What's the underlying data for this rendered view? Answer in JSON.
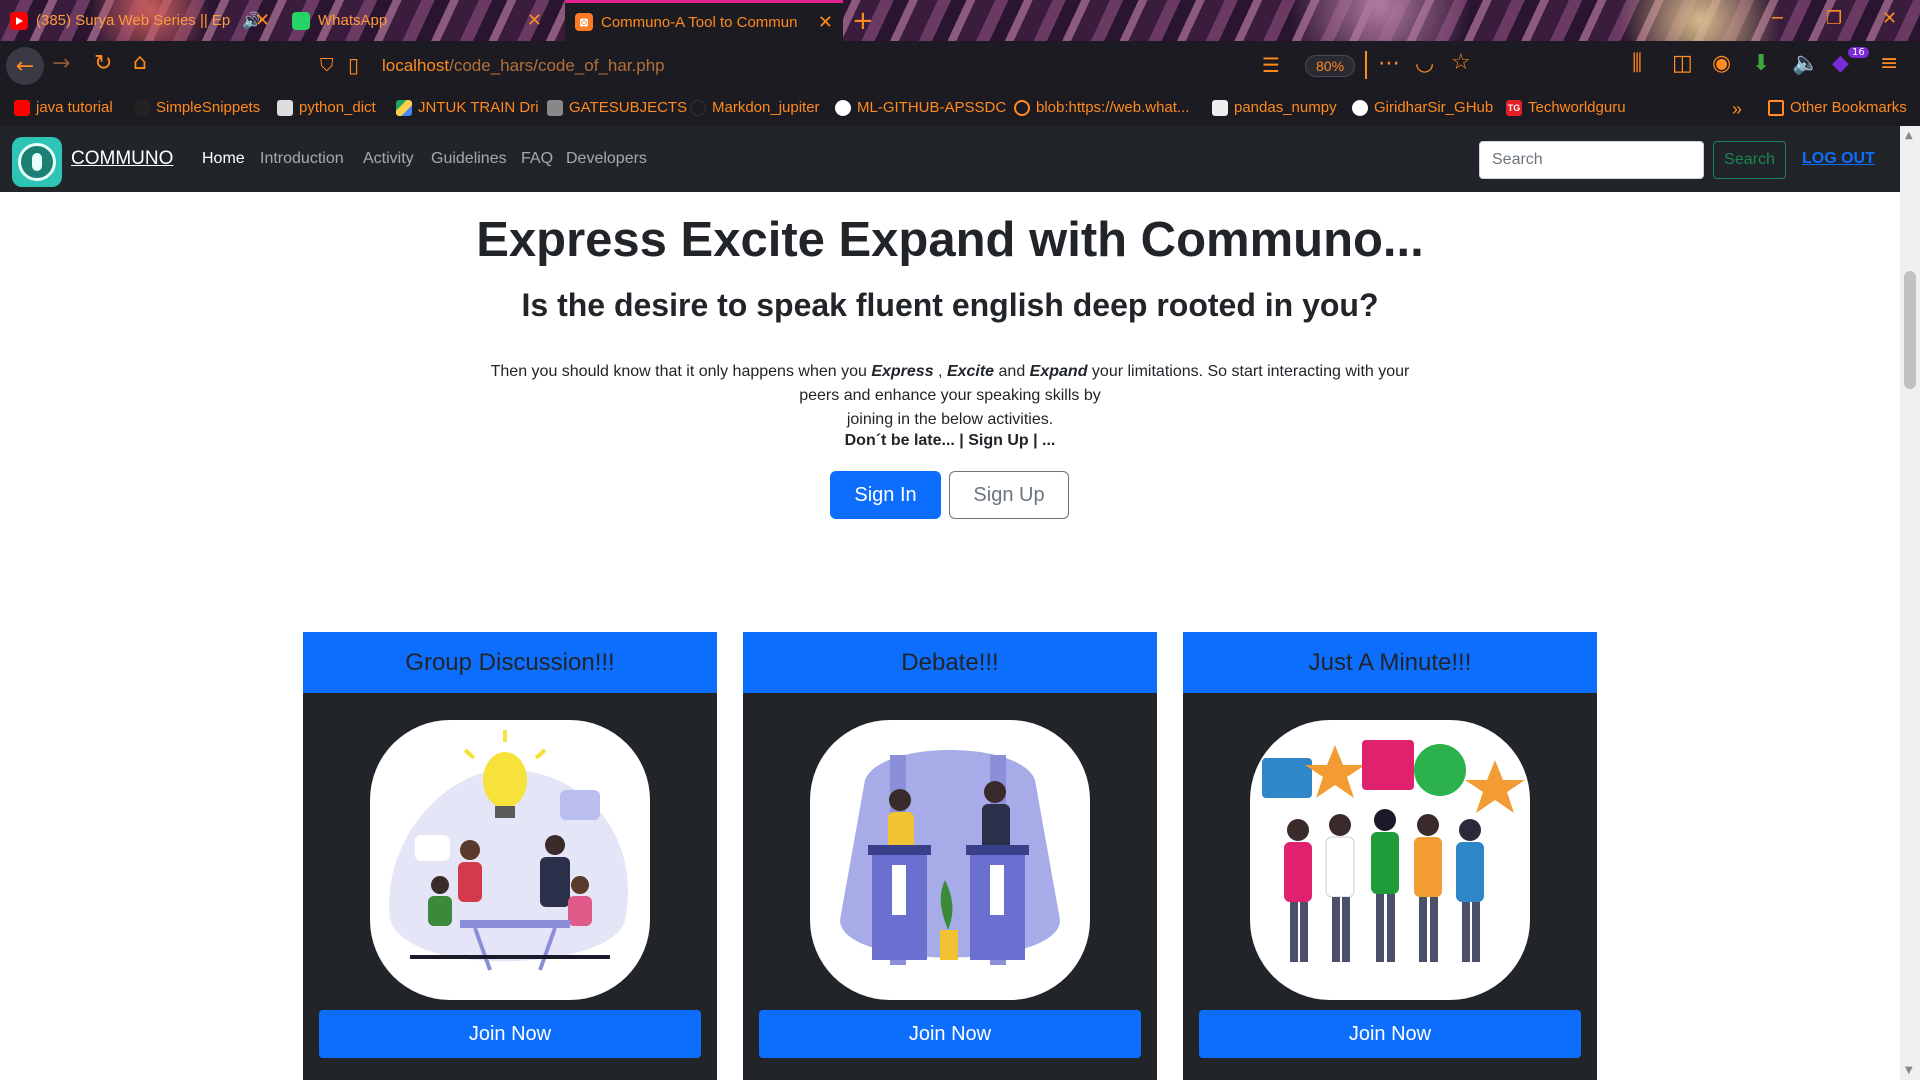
{
  "browser": {
    "tabs": [
      {
        "label": "(385) Surya Web Series || Ep",
        "icon": "youtube-icon"
      },
      {
        "label": "WhatsApp",
        "icon": "whatsapp-icon"
      },
      {
        "label": "Communo-A Tool to Commun",
        "icon": "xampp-icon"
      }
    ],
    "url_host": "localhost",
    "url_path": "/code_hars/code_of_har.php",
    "zoom": "80%",
    "extension_badge": "16",
    "bookmarks": [
      "java tutorial",
      "SimpleSnippets",
      "python_dict",
      "JNTUK TRAIN Dri",
      "GATESUBJECTS",
      "Markdon_jupiter",
      "ML-GITHUB-APSSDC",
      "blob:https://web.what...",
      "pandas_numpy",
      "GiridharSir_GHub",
      "Techworldguru"
    ],
    "other_bookmarks": "Other Bookmarks"
  },
  "site": {
    "brand": "COMMUNO",
    "nav": [
      "Home",
      "Introduction",
      "Activity",
      "Guidelines",
      "FAQ",
      "Developers"
    ],
    "search_placeholder": "Search",
    "search_button": "Search",
    "logout": "LOG OUT"
  },
  "hero": {
    "title": "Express Excite Expand with Communo...",
    "subtitle": "Is the desire to speak fluent english deep rooted in you?",
    "desc_1": "Then you should know that it only happens when you ",
    "desc_express": "Express",
    "desc_2": " , ",
    "desc_excite": "Excite",
    "desc_3": " and ",
    "desc_expand": "Expand",
    "desc_4": " your limitations. So start interacting with your peers and enhance your speaking skills by",
    "desc_5": "joining in the below activities.",
    "tagline": "Don´t be late... | Sign Up | ...",
    "signin": "Sign In",
    "signup": "Sign Up"
  },
  "cards": [
    {
      "title": "Group Discussion!!!",
      "button": "Join Now"
    },
    {
      "title": "Debate!!!",
      "button": "Join Now"
    },
    {
      "title": "Just A Minute!!!",
      "button": "Join Now"
    }
  ],
  "colors": {
    "primary": "#0d6efd",
    "dark": "#212529",
    "success": "#198754",
    "browser_accent": "#ff8a1e"
  }
}
